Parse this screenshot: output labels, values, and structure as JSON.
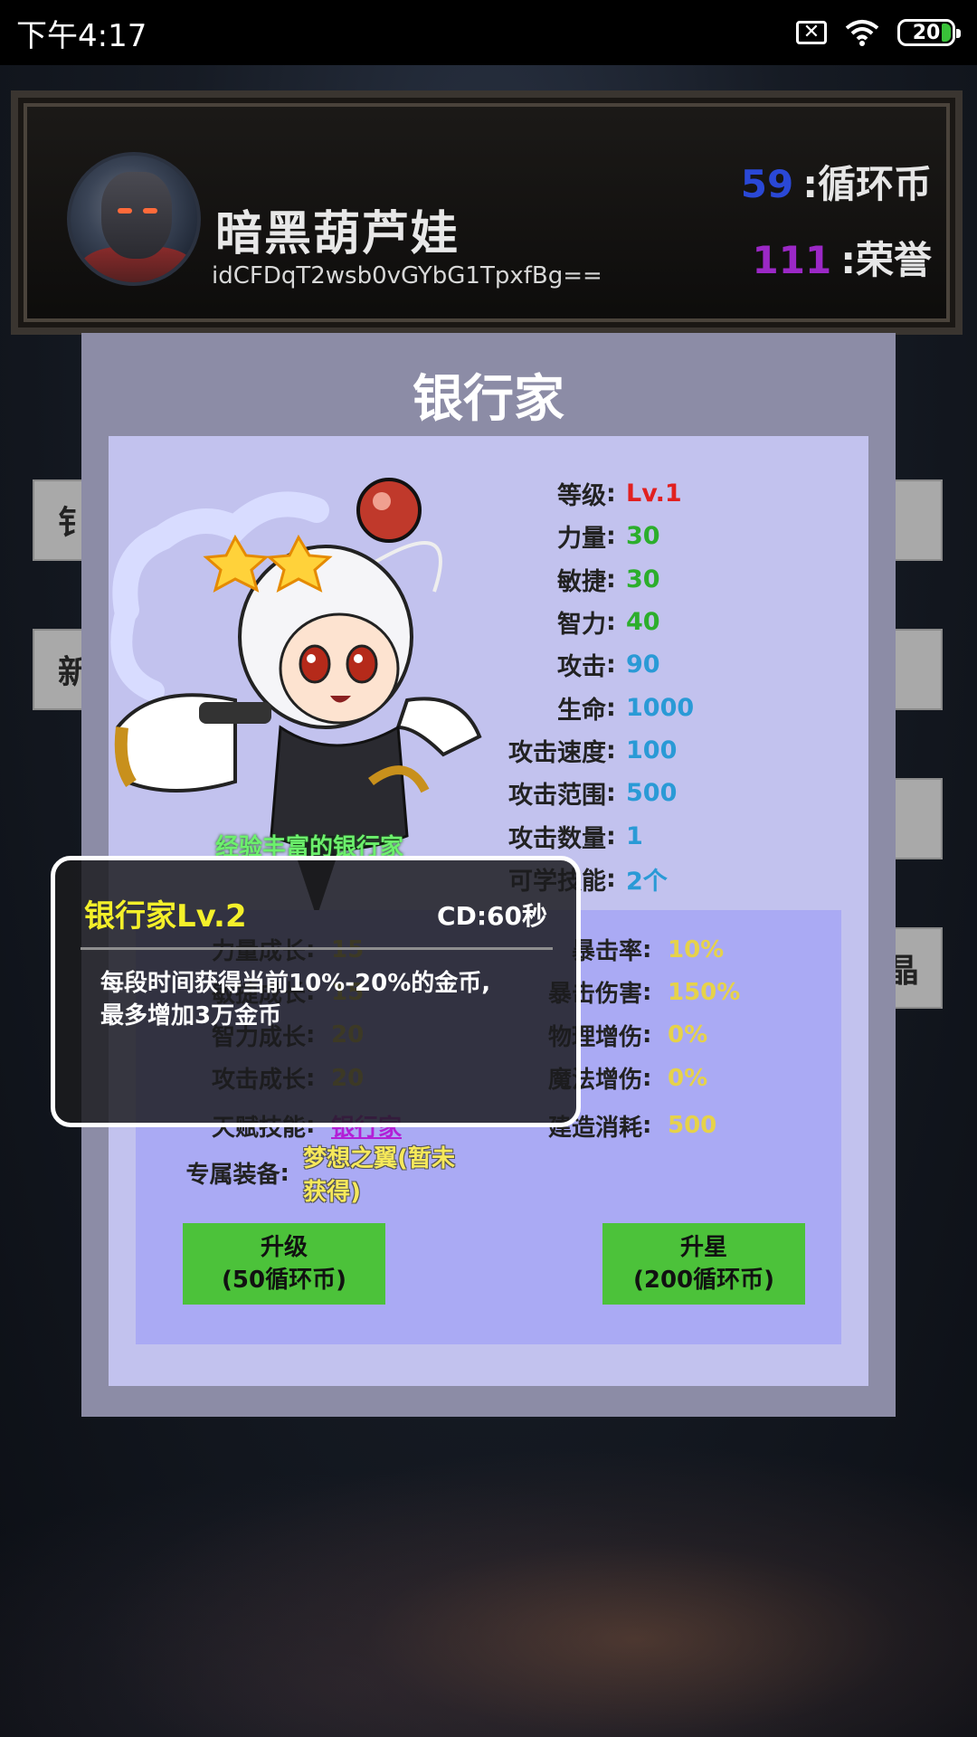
{
  "status_bar": {
    "time": "下午4:17",
    "battery": "20"
  },
  "player": {
    "name": "暗黑葫芦娃",
    "id": "idCFDqT2wsb0vGYbG1TpxfBg==",
    "currency_value": "59",
    "currency_label": ":循环币",
    "honor_value": "111",
    "honor_label": ":荣誉"
  },
  "side_buttons": {
    "left1": "钅",
    "left2": "新",
    "right4": "晶"
  },
  "dialog": {
    "title": "银行家",
    "hero_caption": "经验丰富的银行家",
    "stats": [
      {
        "label": "等级",
        "value": "Lv.1",
        "color": "#e12020"
      },
      {
        "label": "力量",
        "value": "30",
        "color": "#2cae2c"
      },
      {
        "label": "敏捷",
        "value": "30",
        "color": "#2cae2c"
      },
      {
        "label": "智力",
        "value": "40",
        "color": "#2cae2c"
      },
      {
        "label": "攻击",
        "value": "90",
        "color": "#2a9ad6"
      },
      {
        "label": "生命",
        "value": "1000",
        "color": "#2a9ad6"
      },
      {
        "label": "攻击速度",
        "value": "100",
        "color": "#2a9ad6"
      },
      {
        "label": "攻击范围",
        "value": "500",
        "color": "#2a9ad6"
      },
      {
        "label": "攻击数量",
        "value": "1",
        "color": "#2a9ad6"
      },
      {
        "label": "可学技能",
        "value": "2个",
        "color": "#2a9ad6"
      }
    ],
    "growth_left": [
      {
        "label": "力量成长",
        "value": "15"
      },
      {
        "label": "敏捷成长",
        "value": "15"
      },
      {
        "label": "智力成长",
        "value": "20"
      },
      {
        "label": "攻击成长",
        "value": "20"
      }
    ],
    "talent": {
      "label": "天赋技能",
      "value": "银行家"
    },
    "equipment": {
      "label": "专属装备",
      "value": "梦想之翼(暂未获得)"
    },
    "growth_right": [
      {
        "label": "暴击率",
        "value": "10%"
      },
      {
        "label": "暴击伤害",
        "value": "150%"
      },
      {
        "label": "物理增伤",
        "value": "0%"
      },
      {
        "label": "魔法增伤",
        "value": "0%"
      },
      {
        "label": "建造消耗",
        "value": "500"
      }
    ],
    "upgrade_button": {
      "line1": "升级",
      "line2": "(50循环币)"
    },
    "star_button": {
      "line1": "升星",
      "line2": "(200循环币)"
    }
  },
  "tooltip": {
    "title": "银行家Lv.2",
    "cd": "CD:60秒",
    "description": "每段时间获得当前10%-20%的金币,最多增加3万金币"
  },
  "colors": {
    "accent_green": "#4cc23a",
    "dialog_bg": "#8c8ca6",
    "panel_bg": "#c2c2ee",
    "growth_bg": "#aaaaf4"
  },
  "icons": [
    "sim-error-icon",
    "wifi-icon",
    "battery-icon",
    "star-icon"
  ]
}
